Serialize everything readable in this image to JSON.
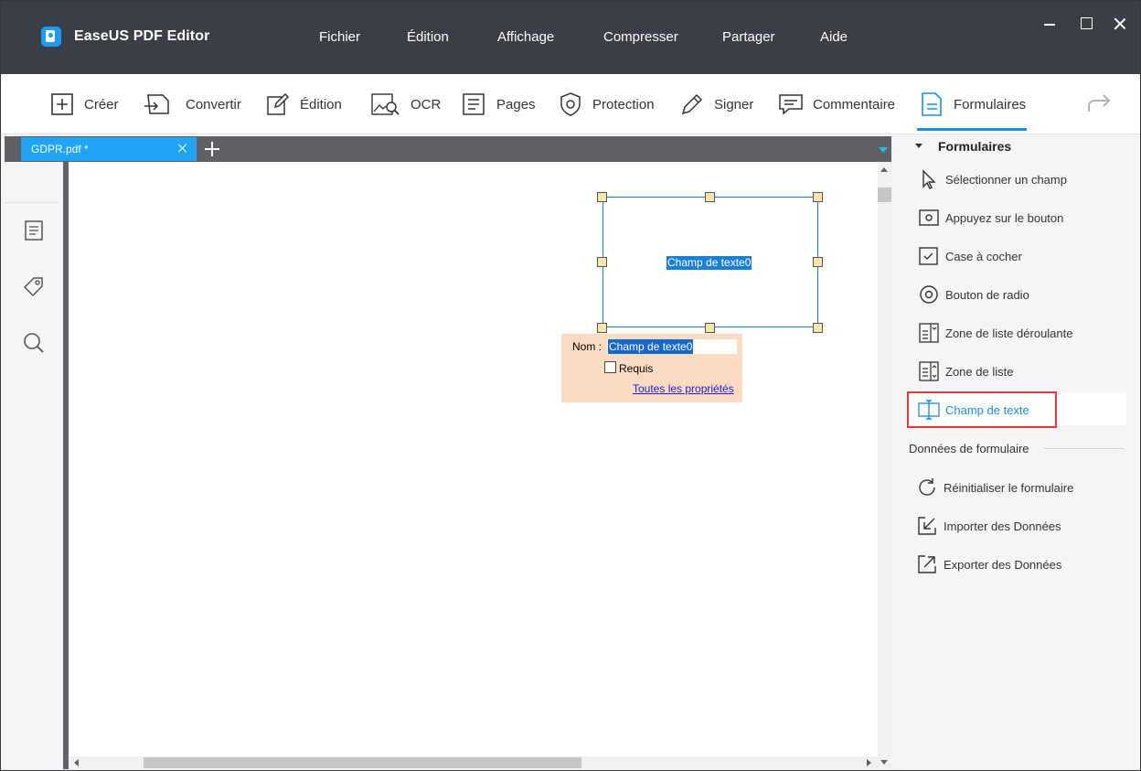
{
  "app": {
    "title": "EaseUS PDF Editor"
  },
  "menu": [
    "Fichier",
    "Édition",
    "Affichage",
    "Compresser",
    "Partager",
    "Aide"
  ],
  "toolbar": {
    "tools": [
      {
        "label": "Créer",
        "icon": "plus-box-icon"
      },
      {
        "label": "Convertir",
        "icon": "convert-icon"
      },
      {
        "label": "Édition",
        "icon": "edit-icon"
      },
      {
        "label": "OCR",
        "icon": "ocr-icon"
      },
      {
        "label": "Pages",
        "icon": "pages-icon"
      },
      {
        "label": "Protection",
        "icon": "shield-icon"
      },
      {
        "label": "Signer",
        "icon": "pen-icon"
      },
      {
        "label": "Commentaire",
        "icon": "comment-icon"
      },
      {
        "label": "Formulaires",
        "icon": "form-icon"
      }
    ],
    "active_tool": "Formulaires"
  },
  "tabs": [
    {
      "label": "GDPR.pdf *"
    }
  ],
  "document": {
    "field_label": "Champ de texte0",
    "popup": {
      "name_label": "Nom :",
      "name_value": "Champ de texte0",
      "required_label": "Requis",
      "required_checked": false,
      "properties_link": "Toutes les propriétés"
    }
  },
  "panel": {
    "header": "Formulaires",
    "items": [
      {
        "label": "Sélectionner un champ",
        "icon": "cursor-icon"
      },
      {
        "label": "Appuyez sur le bouton",
        "icon": "push-button-icon"
      },
      {
        "label": "Case à cocher",
        "icon": "checkbox-icon"
      },
      {
        "label": "Bouton de radio",
        "icon": "radio-icon"
      },
      {
        "label": "Zone de liste déroulante",
        "icon": "dropdown-list-icon"
      },
      {
        "label": "Zone de liste",
        "icon": "list-box-icon"
      },
      {
        "label": "Champ de texte",
        "icon": "text-field-icon"
      }
    ],
    "selected_item": "Champ de texte",
    "data_section": "Données de formulaire",
    "data_items": [
      {
        "label": "Réinitialiser le formulaire",
        "icon": "reset-icon"
      },
      {
        "label": "Importer des Données",
        "icon": "import-icon"
      },
      {
        "label": "Exporter des Données",
        "icon": "export-icon"
      }
    ]
  },
  "colors": {
    "titlebar": "#3b3e45",
    "accent": "#1a8fe3",
    "tab": "#20a4f3",
    "highlight": "#e23a3a",
    "popup_bg": "#fbdcc2"
  }
}
